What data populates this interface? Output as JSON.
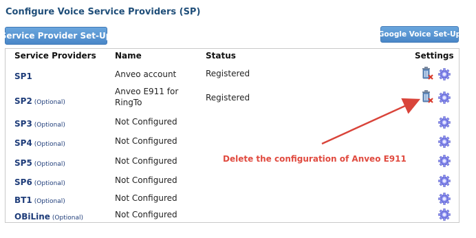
{
  "page": {
    "title": "Configure Voice Service Providers (SP)"
  },
  "buttons": {
    "service_provider_setup": "Service Provider Set-Up",
    "google_voice_setup": "Google Voice Set-Up"
  },
  "table": {
    "headers": {
      "service_providers": "Service Providers",
      "name": "Name",
      "status": "Status",
      "settings": "Settings"
    },
    "rows": [
      {
        "sp": "SP1",
        "optional": "",
        "name": "Anveo account",
        "status": "Registered",
        "delete_icon": true
      },
      {
        "sp": "SP2",
        "optional": "(Optional)",
        "name": "Anveo E911 for RingTo",
        "status": "Registered",
        "delete_icon": true
      },
      {
        "sp": "SP3",
        "optional": "(Optional)",
        "name": "Not Configured",
        "status": "",
        "delete_icon": false
      },
      {
        "sp": "SP4",
        "optional": "(Optional)",
        "name": "Not Configured",
        "status": "",
        "delete_icon": false
      },
      {
        "sp": "SP5",
        "optional": "(Optional)",
        "name": "Not Configured",
        "status": "",
        "delete_icon": false
      },
      {
        "sp": "SP6",
        "optional": "(Optional)",
        "name": "Not Configured",
        "status": "",
        "delete_icon": false
      },
      {
        "sp": "BT1",
        "optional": "(Optional)",
        "name": "Not Configured",
        "status": "",
        "delete_icon": false
      },
      {
        "sp": "OBiLine",
        "optional": "(Optional)",
        "name": "Not Configured",
        "status": "",
        "delete_icon": false
      }
    ]
  },
  "annotation": {
    "text": "Delete the configuration of Anveo E911",
    "color": "#e04a3f"
  },
  "colors": {
    "title": "#1f4e79",
    "button": "#4a87c8",
    "sp_label": "#1f3d7a",
    "gear": "#8a8ef0"
  },
  "icons": {
    "delete": "trash-delete-icon",
    "settings": "gear-icon"
  }
}
